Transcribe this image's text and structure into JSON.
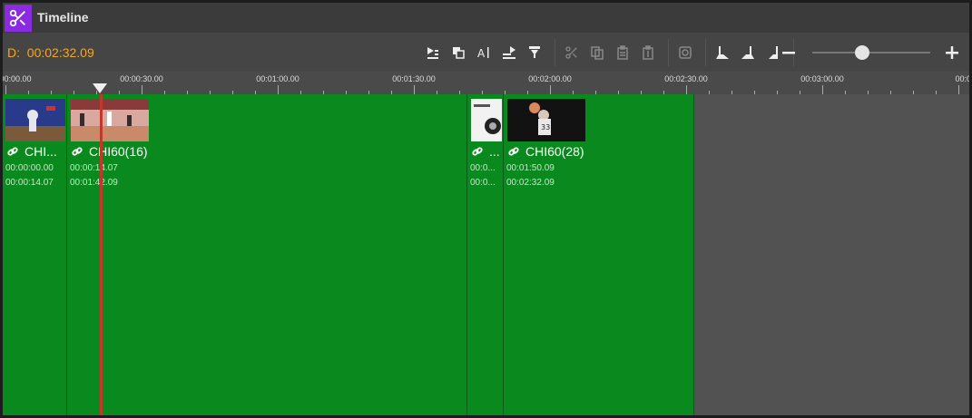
{
  "window": {
    "title": "Timeline",
    "icon": "scissors-icon",
    "accent": "#8a2be2"
  },
  "toolbar": {
    "duration_label": "D:",
    "duration_value": "00:02:32.09",
    "tools": [
      "insert-icon",
      "overwrite-icon",
      "text-icon",
      "lift-icon",
      "extract-icon",
      "cut-icon",
      "copy-icon",
      "paste-icon",
      "paste-insert-icon",
      "snapshot-icon",
      "mark-in-icon",
      "mark-out-icon",
      "mark-clip-icon"
    ],
    "zoom": {
      "level": 0.42
    }
  },
  "ruler": {
    "labels": [
      "00:00:00.00",
      "00:00:30.00",
      "00:01:00.00",
      "00:01:30.00",
      "00:02:00.00",
      "00:02:30.00",
      "00:03:00.00",
      "00:03:30"
    ]
  },
  "clips": [
    {
      "name": "CHI...",
      "start": "00:00:00.00",
      "end": "00:00:14.07"
    },
    {
      "name": "CHI60(16)",
      "start": "00:00:14.07",
      "end": "00:01:42.09"
    },
    {
      "name": "...",
      "start": "00:0...",
      "end": "00:0..."
    },
    {
      "name": "CHI60(28)",
      "start": "00:01:50.09",
      "end": "00:02:32.09"
    }
  ],
  "colors": {
    "clip": "#0a8a1e",
    "playhead": "#c0392b",
    "duration": "#f5a623"
  }
}
